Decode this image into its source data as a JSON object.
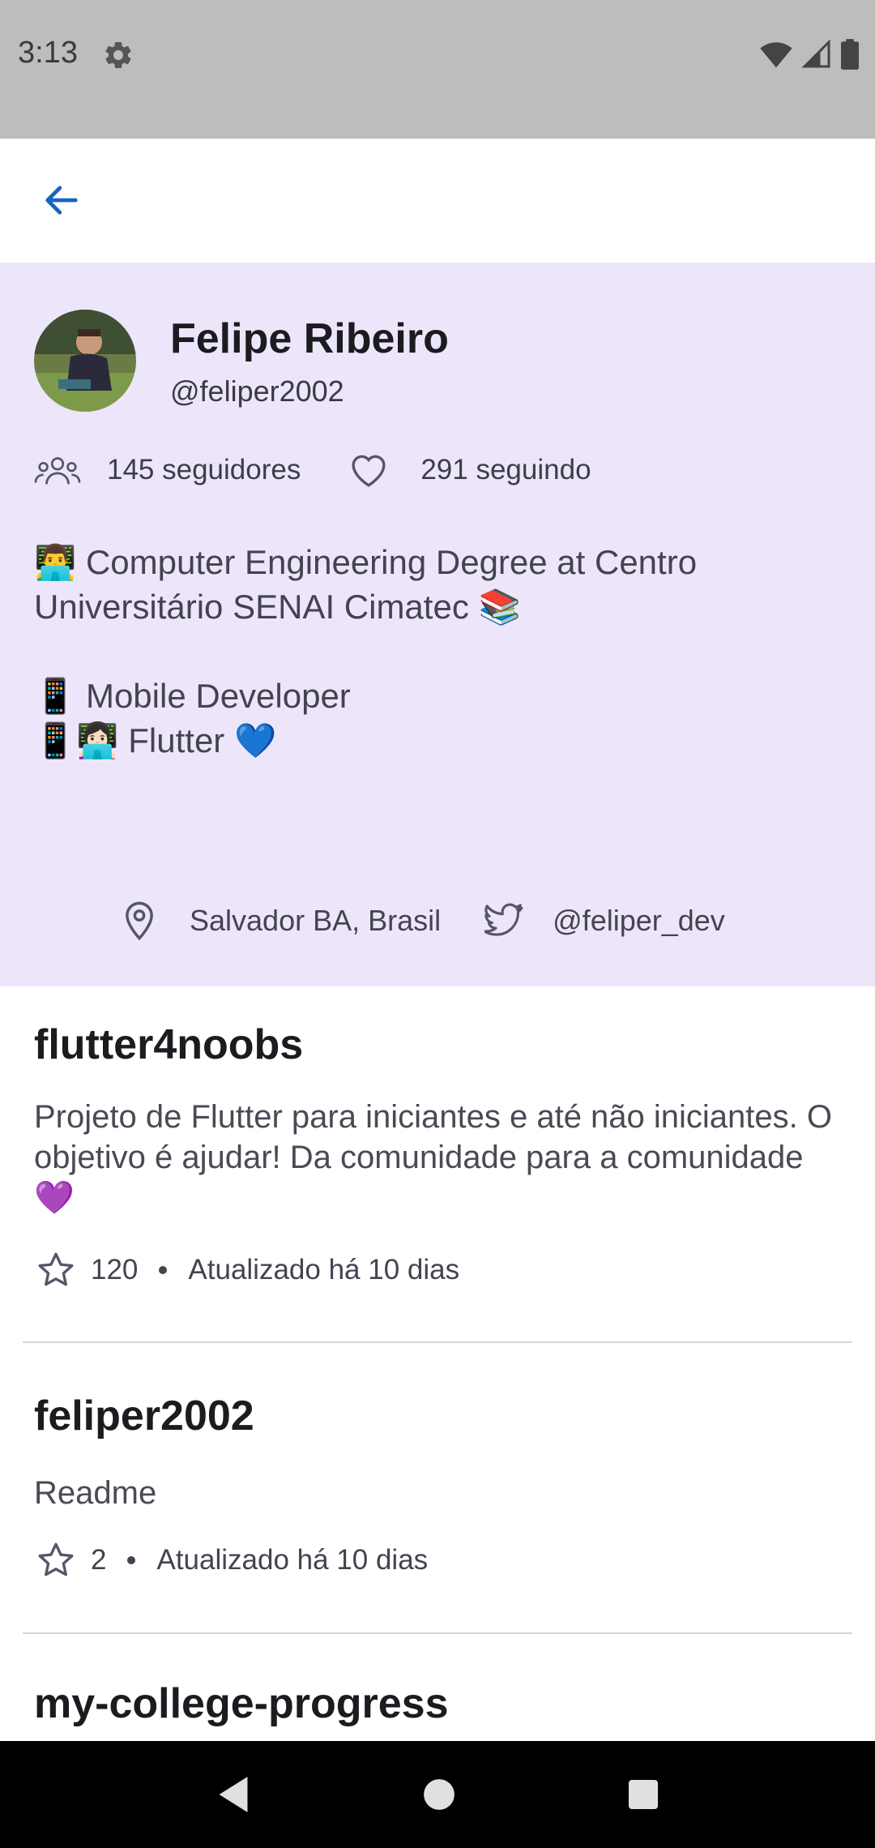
{
  "status_bar": {
    "time": "3:13"
  },
  "profile": {
    "name": "Felipe Ribeiro",
    "handle": "@feliper2002",
    "followers": "145 seguidores",
    "following": "291 seguindo",
    "bio": "👨‍💻 Computer Engineering Degree at Centro Universitário SENAI Cimatec 📚\n\n📱 Mobile Developer\n📱👩🏻‍💻 Flutter 💙",
    "location": "Salvador BA, Brasil",
    "twitter": "@feliper_dev"
  },
  "repos": [
    {
      "title": "flutter4noobs",
      "description": "Projeto de Flutter para iniciantes e até não iniciantes. O objetivo é ajudar! Da comunidade para a comunidade 💜",
      "stars": "120",
      "updated": "Atualizado há 10 dias"
    },
    {
      "title": "feliper2002",
      "description": "Readme",
      "stars": "2",
      "updated": "Atualizado há 10 dias"
    },
    {
      "title": "my-college-progress"
    }
  ],
  "colors": {
    "accent": "#1565c0",
    "profile_bg": "#ede6fb",
    "status_bar": "#bdbdbd"
  },
  "icons": [
    "settings-icon",
    "wifi-icon",
    "signal-icon",
    "battery-icon",
    "back-arrow-icon",
    "people-icon",
    "heart-icon",
    "location-pin-icon",
    "twitter-icon",
    "star-icon",
    "nav-back-icon",
    "nav-home-icon",
    "nav-recents-icon"
  ]
}
